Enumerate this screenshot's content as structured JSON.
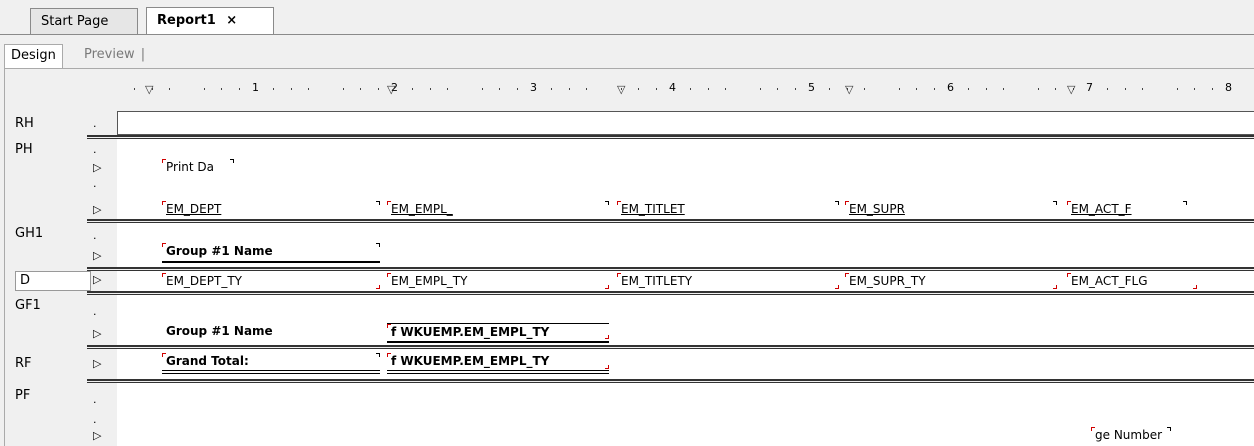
{
  "tabs": [
    {
      "label": "Start Page"
    },
    {
      "label": "Report1",
      "close": "×"
    }
  ],
  "modes": {
    "design": "Design",
    "preview": "Preview",
    "sep": "|"
  },
  "ruler": {
    "numbers": [
      "1",
      "2",
      "3",
      "4",
      "5",
      "6",
      "7",
      "8"
    ]
  },
  "sections": {
    "rh": "RH",
    "ph": "PH",
    "gh1": "GH1",
    "d": "D",
    "gf1": "GF1",
    "rf": "RF",
    "pf": "PF"
  },
  "fields": {
    "print_date": "Print Da",
    "ph_dept": "EM_DEPT",
    "ph_empl": "EM_EMPL_",
    "ph_title": "EM_TITLET",
    "ph_supr": "EM_SUPR",
    "ph_act": "EM_ACT_F",
    "gh_group": "Group #1 Name",
    "d_dept": "EM_DEPT_TY",
    "d_empl": "EM_EMPL_TY",
    "d_title": "EM_TITLETY",
    "d_supr": "EM_SUPR_TY",
    "d_act": "EM_ACT_FLG",
    "gf_group": "Group #1 Name",
    "gf_count": "f WKUEMP.EM_EMPL_TY",
    "rf_grand": "Grand Total:",
    "rf_count": "f WKUEMP.EM_EMPL_TY",
    "pf_page": "ge Number"
  },
  "colors": {
    "handle": "#d00000",
    "band": "#ffffff",
    "bg": "#f0f0f0"
  }
}
